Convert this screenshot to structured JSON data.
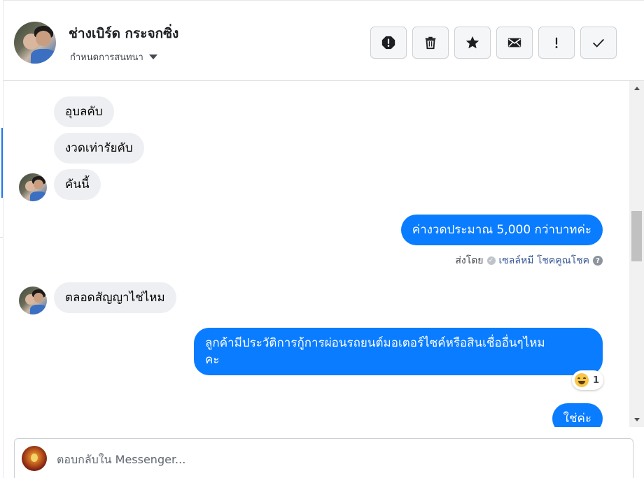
{
  "header": {
    "name": "ช่างเบิร์ด กระจกซิ่ง",
    "assign_label": "กำหนดการสนทนา",
    "toolbar": [
      {
        "icon": "spam-alert-icon"
      },
      {
        "icon": "trash-icon"
      },
      {
        "icon": "star-icon"
      },
      {
        "icon": "mail-icon"
      },
      {
        "icon": "exclamation-icon"
      },
      {
        "icon": "checkmark-icon"
      }
    ]
  },
  "thread": {
    "messages": [
      {
        "side": "in",
        "text": "อุบลคับ"
      },
      {
        "side": "in",
        "text": "งวดเท่ารัยคับ"
      },
      {
        "side": "in",
        "text": "คันนี้"
      },
      {
        "side": "out",
        "text": "ค่างวดประมาณ 5,000 กว่าบาทค่ะ"
      },
      {
        "side": "in",
        "text": "ตลอดสัญญาไช่ไหม"
      },
      {
        "side": "out",
        "text_line1": "ลูกค้ามีประวัติการกู้การผ่อนรถยนต์มอเตอร์ไซค์หรือสินเชื่ออื่นๆไหม",
        "text_line2": "คะ"
      },
      {
        "side": "out",
        "text": "ใช่ค่ะ"
      }
    ],
    "sent_by": {
      "prefix": "ส่งโดย",
      "name": "เซลล์หมี โชคคูณโชค",
      "help": "?"
    },
    "reaction": {
      "emoji": "laughing-emoji",
      "count": "1"
    }
  },
  "composer": {
    "placeholder": "ตอบกลับใน Messenger..."
  },
  "colors": {
    "outgoing_bubble": "#0a7cff",
    "incoming_bubble": "#eeeff2",
    "accent": "#1877f2"
  }
}
